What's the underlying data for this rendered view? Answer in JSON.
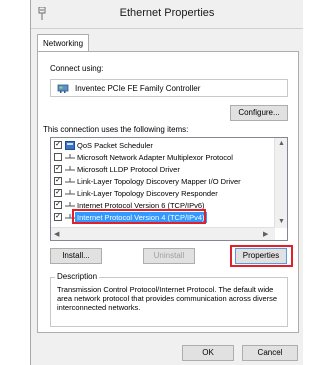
{
  "window": {
    "title": "Ethernet Properties"
  },
  "tabs": [
    {
      "label": "Networking"
    }
  ],
  "connect_using": {
    "label": "Connect using:",
    "adapter": "Inventec PCIe FE Family Controller",
    "configure_button": "Configure..."
  },
  "components": {
    "label": "This connection uses the following items:",
    "items": [
      {
        "label": "QoS Packet Scheduler",
        "checked": true,
        "icon": "qos-icon"
      },
      {
        "label": "Microsoft Network Adapter Multiplexor Protocol",
        "checked": false,
        "icon": "protocol-icon"
      },
      {
        "label": "Microsoft LLDP Protocol Driver",
        "checked": true,
        "icon": "protocol-icon"
      },
      {
        "label": "Link-Layer Topology Discovery Mapper I/O Driver",
        "checked": true,
        "icon": "protocol-icon"
      },
      {
        "label": "Link-Layer Topology Discovery Responder",
        "checked": true,
        "icon": "protocol-icon"
      },
      {
        "label": "Internet Protocol Version 6 (TCP/IPv6)",
        "checked": true,
        "icon": "protocol-icon"
      },
      {
        "label": "Internet Protocol Version 4 (TCP/IPv4)",
        "checked": true,
        "icon": "protocol-icon",
        "selected": true
      }
    ],
    "check_glyph": "✓",
    "install_button": "Install...",
    "uninstall_button": "Uninstall",
    "properties_button": "Properties"
  },
  "description": {
    "legend": "Description",
    "text": "Transmission Control Protocol/Internet Protocol. The default wide area network protocol that provides communication across diverse interconnected networks."
  },
  "footer": {
    "ok_button": "OK",
    "cancel_button": "Cancel"
  },
  "colors": {
    "selection": "#3399ff",
    "highlight": "#e0202a"
  }
}
